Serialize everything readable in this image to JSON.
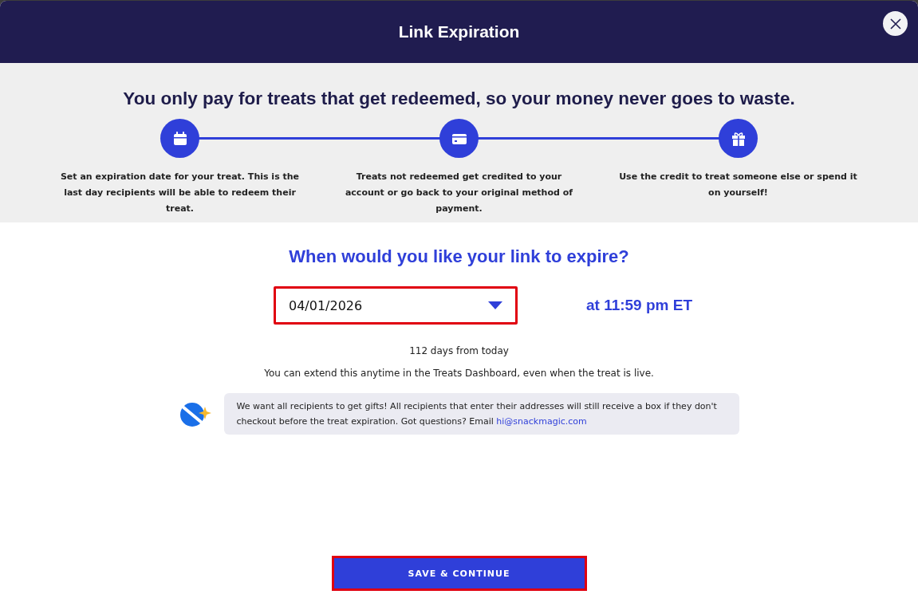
{
  "dialog": {
    "title": "Link Expiration"
  },
  "banner": {
    "headline": "You only pay for treats that get redeemed, so your money never goes to waste.",
    "steps": [
      {
        "kind": "calendar",
        "text": "Set an expiration date for your treat. This is the last day recipients will be able to redeem their treat."
      },
      {
        "kind": "card",
        "text": "Treats not redeemed get credited to your account or go back to your original method of payment."
      },
      {
        "kind": "gift",
        "text": "Use the credit to treat someone else or spend it on yourself!"
      }
    ]
  },
  "question": "When would you like your link to expire?",
  "date_field": {
    "value": "04/01/2026"
  },
  "time_label": "at 11:59 pm ET",
  "days_note": "112 days from today",
  "extend_note": "You can extend this anytime in the Treats Dashboard, even when the treat is live.",
  "info": {
    "text": "We want all recipients to get gifts! All recipients that enter their addresses will still receive a box if they don't checkout before the treat expiration. Got questions? Email",
    "link": "hi@snackmagic.com"
  },
  "primary_button": "SAVE & CONTINUE"
}
